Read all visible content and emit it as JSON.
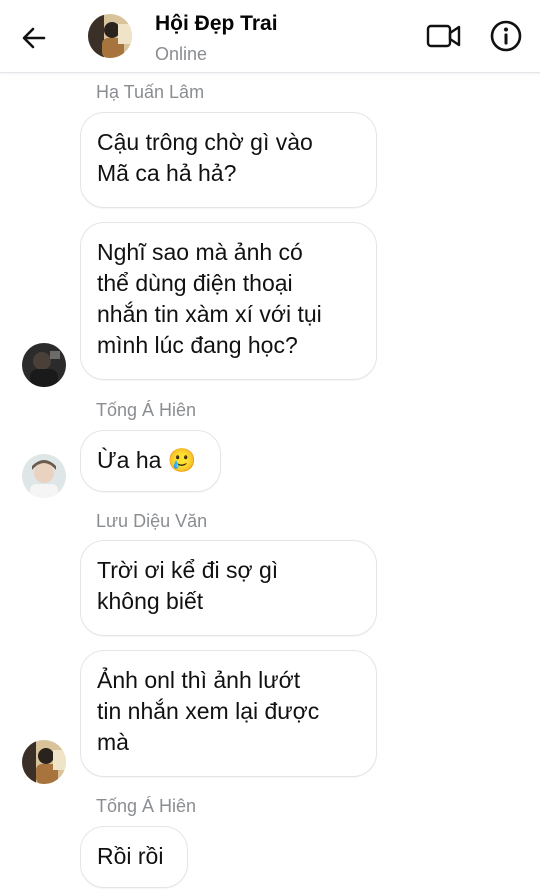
{
  "header": {
    "title": "Hội Đẹp Trai",
    "status": "Online",
    "icons": {
      "back": "back-arrow-icon",
      "video": "video-call-icon",
      "info": "info-icon"
    }
  },
  "messages": [
    {
      "sender": "Hạ Tuấn Lâm",
      "lines": [
        "Cậu trông chờ gì vào",
        "Mã ca hả hả?"
      ]
    },
    {
      "lines": [
        "Nghĩ sao mà ảnh có",
        "thể dùng điện thoại",
        "nhắn tin xàm xí với tụi",
        "mình lúc đang học?"
      ]
    },
    {
      "sender": "Tống Á Hiên",
      "lines": [
        "Ừa ha"
      ],
      "emoji": "🥲"
    },
    {
      "sender": "Lưu Diệu Văn",
      "lines": [
        "Trời ơi kể đi sợ gì",
        "không biết"
      ]
    },
    {
      "lines": [
        "Ảnh onl thì ảnh lướt",
        "tin nhắn xem lại được",
        "mà"
      ]
    },
    {
      "sender": "Tống Á Hiên",
      "lines": [
        "Rồi rồi"
      ]
    }
  ]
}
